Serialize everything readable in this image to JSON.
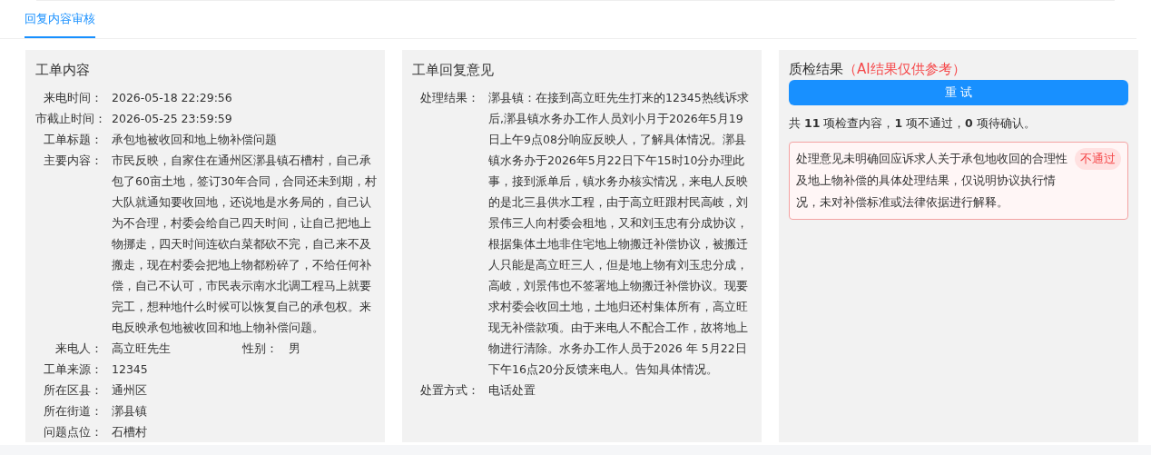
{
  "tabs": [
    {
      "label": "回复内容审核",
      "selected": true
    }
  ],
  "order_content": {
    "title": "工单内容",
    "fields": [
      {
        "label": "来电时间：",
        "value": "2026-05-18 22:29:56"
      },
      {
        "label": "市截止时间：",
        "value": "2026-05-25 23:59:59"
      },
      {
        "label": "工单标题：",
        "value": "承包地被收回和地上物补偿问题"
      },
      {
        "label": "主要内容：",
        "value": "市民反映，自家住在通州区漷县镇石槽村，自己承包了60亩土地，签订30年合同，合同还未到期，村大队就通知要收回地，还说地是水务局的，自己认为不合理，村委会给自己四天时间，让自己把地上物挪走，四天时间连砍白菜都砍不完，自己来不及搬走，现在村委会把地上物都粉碎了，不给任何补偿，自己不认可，市民表示南水北调工程马上就要完工，想种地什么时候可以恢复自己的承包权。来电反映承包地被收回和地上物补偿问题。"
      },
      {
        "label": "来电人：",
        "value": "高立旺先生",
        "extra": {
          "label": "性别：",
          "value": "男"
        }
      },
      {
        "label": "工单来源：",
        "value": "12345"
      },
      {
        "label": "所在区县：",
        "value": "通州区"
      },
      {
        "label": "所在街道：",
        "value": "漷县镇"
      },
      {
        "label": "问题点位：",
        "value": "石槽村"
      }
    ]
  },
  "reply": {
    "title": "工单回复意见",
    "fields": [
      {
        "label": "处理结果：",
        "value": "漷县镇：在接到高立旺先生打来的12345热线诉求后,漷县镇水务办工作人员刘小月于2026年5月19日上午9点08分响应反映人，了解具体情况。漷县镇水务办于2026年5月22日下午15时10分办理此事，接到派单后，镇水务办核实情况，来电人反映的是北三县供水工程，由于高立旺跟村民高岐，刘景伟三人向村委会租地，又和刘玉忠有分成协议，根据集体土地非住宅地上物搬迁补偿协议，被搬迁人只能是高立旺三人，但是地上物有刘玉忠分成，高岐，刘景伟也不签署地上物搬迁补偿协议。现要求村委会收回土地，土地归还村集体所有，高立旺现无补偿款项。由于来电人不配合工作，故将地上物进行清除。水务办工作人员于2026 年 5月22日下午16点20分反馈来电人。告知具体情况。"
      },
      {
        "label": "处置方式：",
        "value": "电话处置"
      }
    ]
  },
  "quality": {
    "title": "质检结果",
    "note": "（AI结果仅供参考）",
    "retry_button": "重 试",
    "summary": "共 **11** 项检查内容，**1** 项不通过，**0** 项待确认。",
    "issues": [
      {
        "text": "处理意见未明确回应诉求人关于承包地收回的合理性及地上物补偿的具体处理结果，仅说明协议执行情况，未对补偿标准或法律依据进行解释。",
        "status": "不通过",
        "passed": false
      }
    ]
  }
}
